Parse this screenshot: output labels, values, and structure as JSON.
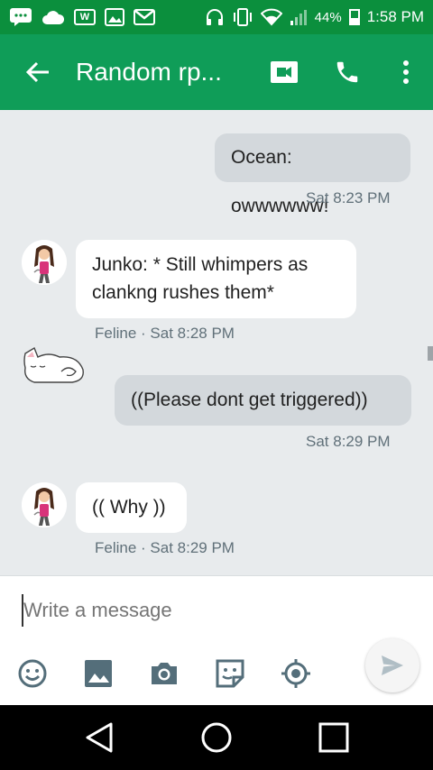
{
  "status_bar": {
    "battery": "44%",
    "time": "1:58 PM",
    "icons": [
      "chat-notification-icon",
      "cloud-icon",
      "w-app-icon",
      "image-icon",
      "gmail-icon",
      "headphones-icon",
      "vibrate-icon",
      "wifi-icon",
      "signal-icon",
      "battery-icon"
    ],
    "w_label": "W"
  },
  "app_bar": {
    "title": "Random rp...",
    "icons": [
      "back-arrow-icon",
      "video-call-icon",
      "phone-icon",
      "more-vert-icon"
    ]
  },
  "messages": [
    {
      "direction": "outgoing",
      "lines": [
        "Ocean: owwwwww!"
      ],
      "meta": "Sat 8:23 PM"
    },
    {
      "direction": "incoming",
      "lines": [
        "Junko: * Still whimpers as",
        "clankng rushes them*"
      ],
      "meta": "Feline · Sat 8:28 PM"
    },
    {
      "direction": "outgoing",
      "lines": [
        "((Please dont get triggered))"
      ],
      "meta": "Sat 8:29 PM"
    },
    {
      "direction": "incoming",
      "lines": [
        "(( Why ))"
      ],
      "meta": "Feline · Sat 8:29 PM"
    }
  ],
  "composer": {
    "placeholder": "Write a message",
    "tools": [
      "emoji-icon",
      "gallery-icon",
      "camera-icon",
      "sticker-icon",
      "location-icon"
    ],
    "send": "send-icon"
  },
  "colors": {
    "status_bar": "#0b8f3d",
    "app_bar": "#0f9d58",
    "conversation_bg": "#e8ebed",
    "outgoing_bubble": "#d3d8dc",
    "incoming_bubble": "#ffffff",
    "icon_gray": "#546e7a"
  },
  "nav_bar": {
    "icons": [
      "back-triangle-icon",
      "home-circle-icon",
      "recents-square-icon"
    ]
  }
}
